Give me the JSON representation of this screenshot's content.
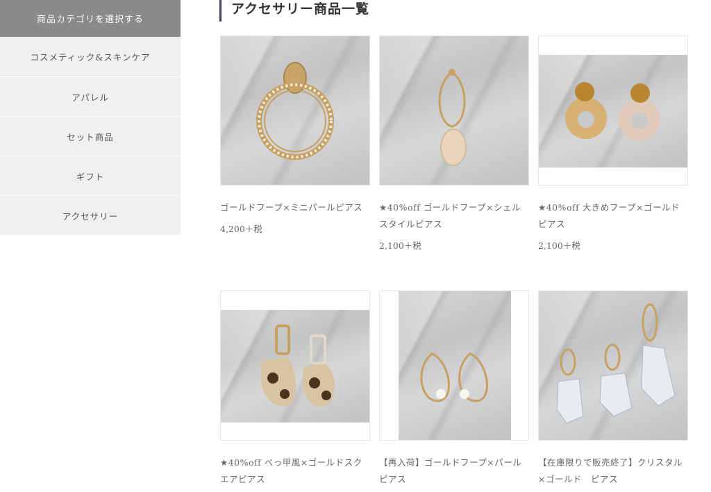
{
  "sidebar": {
    "header": "商品カテゴリを選択する",
    "items": [
      {
        "label": "コスメティック&スキンケア"
      },
      {
        "label": "アパレル"
      },
      {
        "label": "セット商品"
      },
      {
        "label": "ギフト"
      },
      {
        "label": "アクセサリー"
      }
    ]
  },
  "page": {
    "title": "アクセサリー商品一覧"
  },
  "products": [
    {
      "name": "ゴールドフープ×ミニパールピアス",
      "price": "4,200＋税"
    },
    {
      "name": "★40%off ゴールドフープ×シェルスタイルピアス",
      "price": "2,100＋税"
    },
    {
      "name": "★40%off 大きめフープ×ゴールドピアス",
      "price": "2,100＋税"
    },
    {
      "name": "★40%off べっ甲風×ゴールドスクエアピアス",
      "price": ""
    },
    {
      "name": "【再入荷】ゴールドフープ×パール　ピアス",
      "price": ""
    },
    {
      "name": "【在庫限りで販売終了】クリスタル×ゴールド　ピアス",
      "price": ""
    }
  ]
}
